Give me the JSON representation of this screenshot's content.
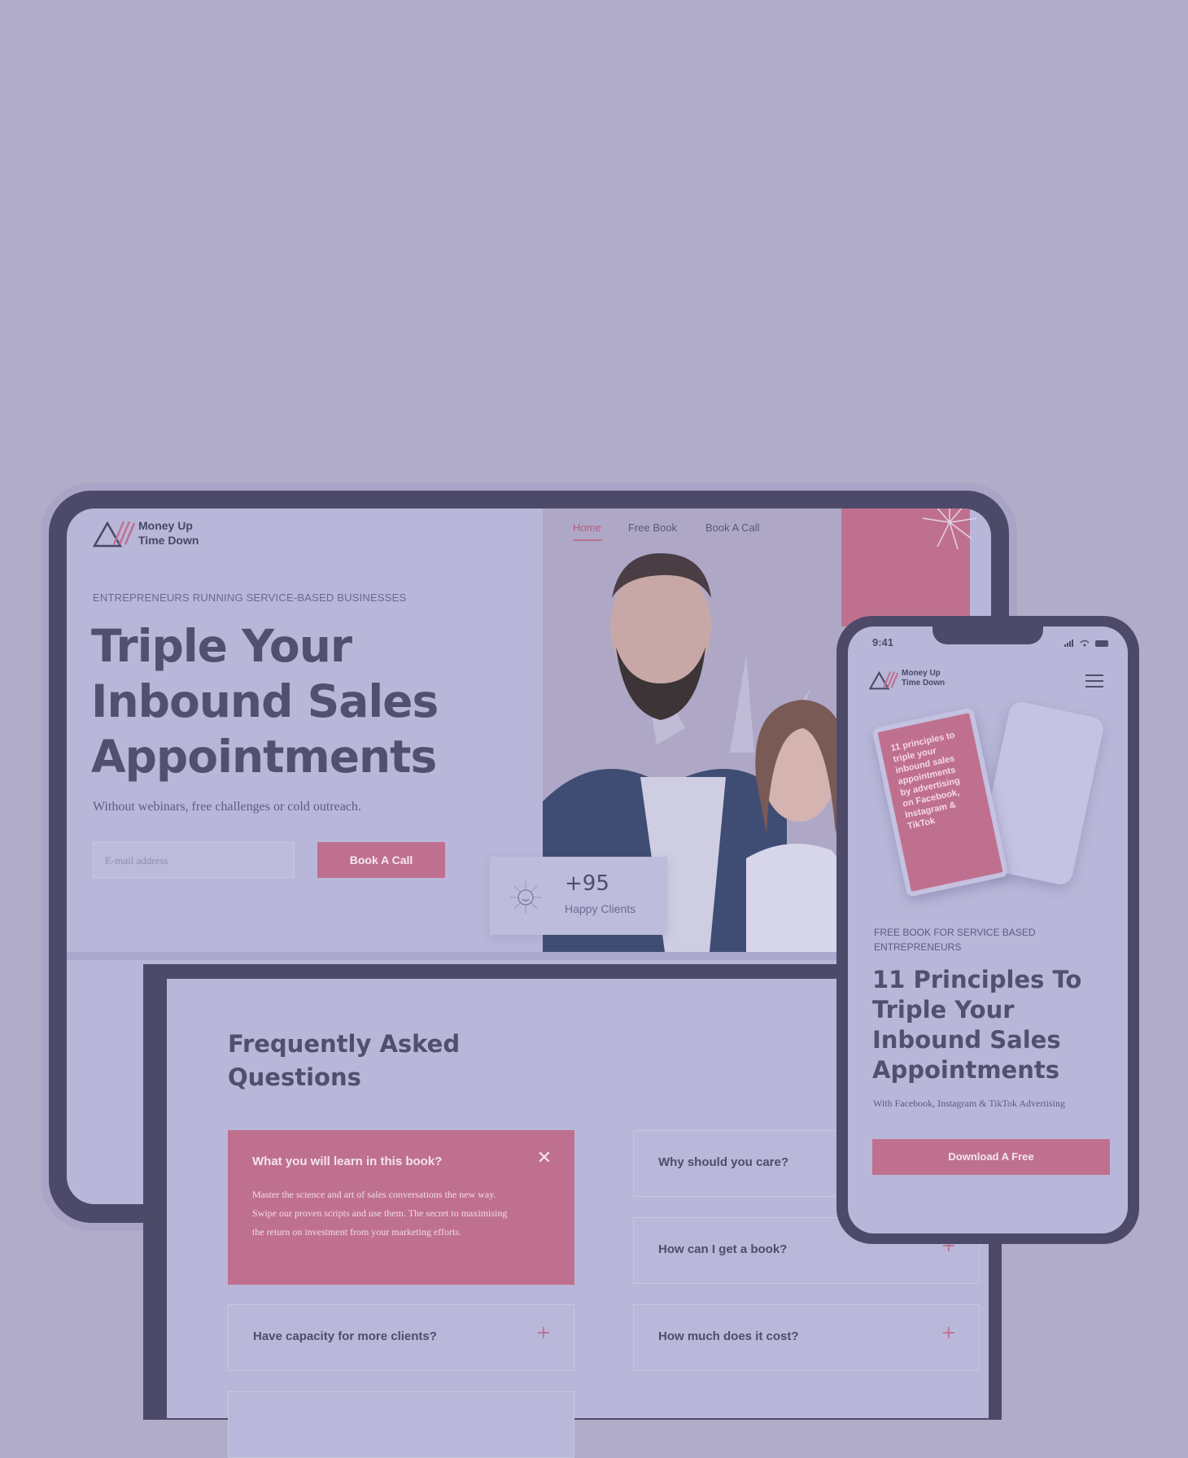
{
  "tablet": {
    "logo_text": "Money Up\nTime Down",
    "nav": [
      "Home",
      "Free Book",
      "Book A Call"
    ],
    "eyebrow": "ENTREPRENEURS RUNNING SERVICE-BASED BUSINESSES",
    "headline": "Triple Your Inbound Sales Appointments",
    "subheadline": "Without webinars, free challenges or cold outreach.",
    "email_placeholder": "E-mail address",
    "cta_label": "Book A Call",
    "stat_value": "+95",
    "stat_label": "Happy Clients"
  },
  "faq": {
    "title": "Frequently Asked Questions",
    "open_item": {
      "question": "What you will learn in this book?",
      "answer": "Master the science and art of sales conversations the new way. Swipe our proven scripts and use them. The secret to maximising the return on investment from your marketing efforts."
    },
    "items": [
      "Why should you care?",
      "How can I get a book?",
      "Have capacity for more clients?",
      "How much does it cost?"
    ]
  },
  "phone": {
    "time": "9:41",
    "logo_text": "Money Up\nTime Down",
    "book_text": "11 principles to triple your inbound sales appointments by advertising on Facebook, Instagram & TikTok",
    "eyebrow": "FREE BOOK FOR SERVICE BASED ENTREPRENEURS",
    "headline": "11 Principles To Triple Your Inbound Sales Appointments",
    "subheadline": "With Facebook, Instagram & TikTok Advertising",
    "cta_label": "Download A Free"
  },
  "colors": {
    "background": "#b1adc9",
    "accent_pink": "#c0708f",
    "frame": "#4d4a69",
    "screen": "#b8b7d9",
    "text_dark": "#524f70"
  },
  "icons": [
    "logo-mark-icon",
    "starburst-icon",
    "smile-icon",
    "close-icon",
    "plus-icon",
    "hamburger-menu-icon",
    "signal-icon",
    "wifi-icon",
    "battery-icon"
  ]
}
